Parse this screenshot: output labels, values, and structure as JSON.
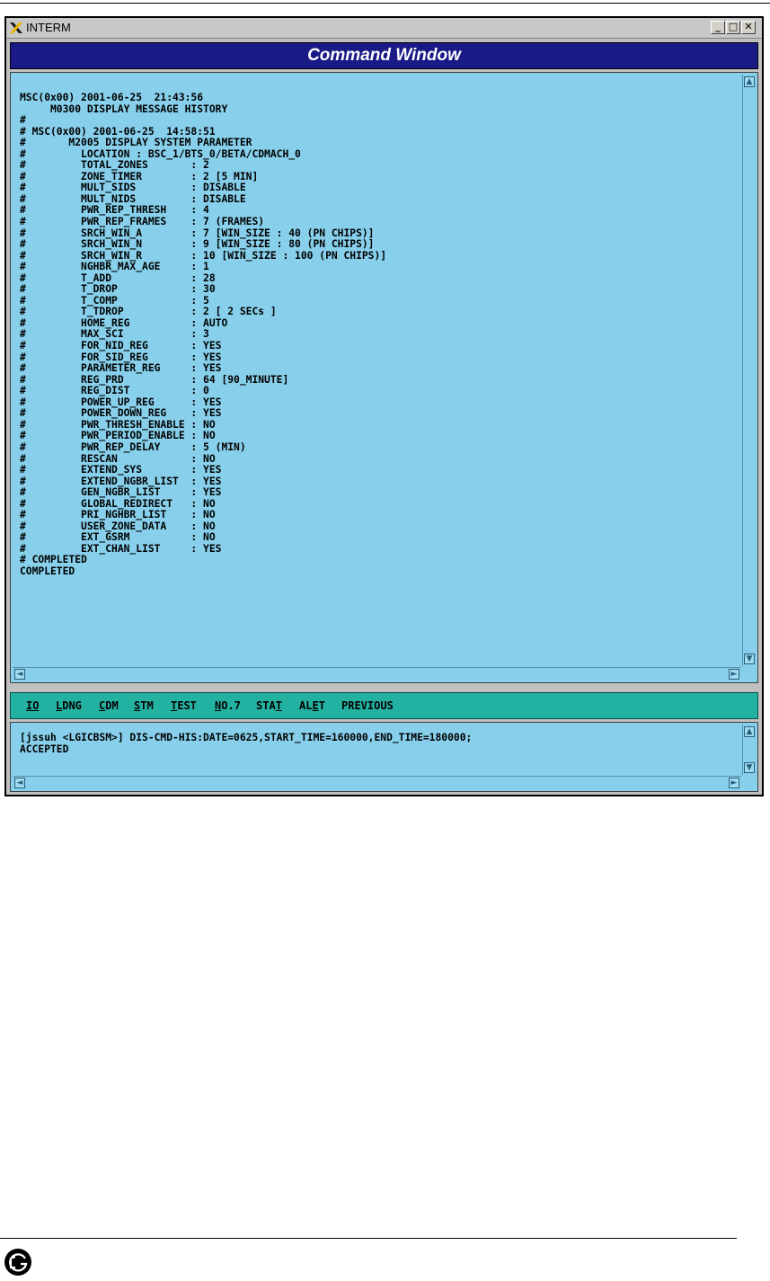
{
  "window": {
    "app_title": "INTERM",
    "minimize": "_",
    "maximize": "□",
    "close": "✕"
  },
  "header": {
    "title": "Command Window"
  },
  "output": {
    "lines": [
      "MSC(0x00) 2001-06-25  21:43:56",
      "     M0300 DISPLAY MESSAGE HISTORY",
      "#",
      "# MSC(0x00) 2001-06-25  14:58:51",
      "#       M2005 DISPLAY SYSTEM PARAMETER",
      "#         LOCATION : BSC_1/BTS_0/BETA/CDMACH_0",
      "#         TOTAL_ZONES       : 2",
      "#         ZONE_TIMER        : 2 [5 MIN]",
      "#         MULT_SIDS         : DISABLE",
      "#         MULT_NIDS         : DISABLE",
      "#         PWR_REP_THRESH    : 4",
      "#         PWR_REP_FRAMES    : 7 (FRAMES)",
      "#         SRCH_WIN_A        : 7 [WIN_SIZE : 40 (PN CHIPS)]",
      "#         SRCH_WIN_N        : 9 [WIN_SIZE : 80 (PN CHIPS)]",
      "#         SRCH_WIN_R        : 10 [WIN_SIZE : 100 (PN CHIPS)]",
      "#         NGHBR_MAX_AGE     : 1",
      "#         T_ADD             : 28",
      "#         T_DROP            : 30",
      "#         T_COMP            : 5",
      "#         T_TDROP           : 2 [ 2 SECs ]",
      "#         HOME_REG          : AUTO",
      "#         MAX_SCI           : 3",
      "#         FOR_NID_REG       : YES",
      "#         FOR_SID_REG       : YES",
      "#         PARAMETER_REG     : YES",
      "#         REG_PRD           : 64 [90_MINUTE]",
      "#         REG_DIST          : 0",
      "#         POWER_UP_REG      : YES",
      "#         POWER_DOWN_REG    : YES",
      "#         PWR_THRESH_ENABLE : NO",
      "#         PWR_PERIOD_ENABLE : NO",
      "#         PWR_REP_DELAY     : 5 (MIN)",
      "#         RESCAN            : NO",
      "#         EXTEND_SYS        : YES",
      "#         EXTEND_NGBR_LIST  : YES",
      "#         GEN_NGBR_LIST     : YES",
      "#         GLOBAL_REDIRECT   : NO",
      "#         PRI_NGHBR_LIST    : NO",
      "#         USER_ZONE_DATA    : NO",
      "#         EXT_GSRM          : NO",
      "#         EXT_CHAN_LIST     : YES",
      "# COMPLETED",
      "COMPLETED"
    ]
  },
  "menu": {
    "items": [
      {
        "pre": "",
        "u": "IO",
        "post": ""
      },
      {
        "pre": "",
        "u": "L",
        "post": "DNG"
      },
      {
        "pre": "",
        "u": "C",
        "post": "DM"
      },
      {
        "pre": "",
        "u": "S",
        "post": "TM"
      },
      {
        "pre": "",
        "u": "T",
        "post": "EST"
      },
      {
        "pre": "",
        "u": "N",
        "post": "O.7"
      },
      {
        "pre": "STA",
        "u": "T",
        "post": ""
      },
      {
        "pre": "AL",
        "u": "E",
        "post": "T"
      },
      {
        "pre": "",
        "u": "",
        "post": "PREVIOUS"
      }
    ]
  },
  "input": {
    "lines": [
      "[jssuh <LGICBSM>] DIS-CMD-HIS:DATE=0625,START_TIME=160000,END_TIME=180000;",
      "ACCEPTED"
    ]
  },
  "scroll": {
    "up": "▲",
    "down": "▼",
    "left": "◄",
    "right": "►"
  }
}
